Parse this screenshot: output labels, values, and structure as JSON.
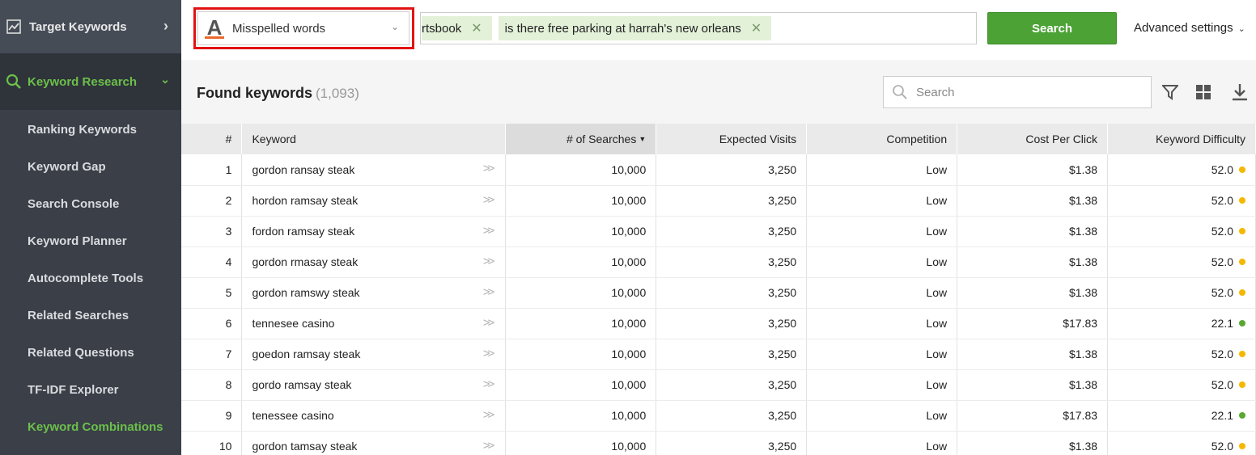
{
  "sidebar": {
    "top_item": "Target Keywords",
    "section": "Keyword Research",
    "items": [
      {
        "label": "Ranking Keywords"
      },
      {
        "label": "Keyword Gap"
      },
      {
        "label": "Search Console"
      },
      {
        "label": "Keyword Planner"
      },
      {
        "label": "Autocomplete Tools"
      },
      {
        "label": "Related Searches"
      },
      {
        "label": "Related Questions"
      },
      {
        "label": "TF-IDF Explorer"
      },
      {
        "label": "Keyword Combinations"
      }
    ],
    "current_item": "Keyword Combinations"
  },
  "topbar": {
    "mode_select": "Misspelled words",
    "mode_icon_letter": "A",
    "tags": [
      "rtsbook",
      "is there free parking at harrah's new orleans"
    ],
    "search_button": "Search",
    "advanced_settings": "Advanced settings"
  },
  "main": {
    "title": "Found keywords",
    "count": "(1,093)",
    "search_placeholder": "Search"
  },
  "table": {
    "headers": {
      "index": "#",
      "keyword": "Keyword",
      "searches": "# of Searches",
      "visits": "Expected Visits",
      "competition": "Competition",
      "cpc": "Cost Per Click",
      "difficulty": "Keyword Difficulty"
    },
    "rows": [
      {
        "idx": "1",
        "keyword": "gordon ransay steak",
        "searches": "10,000",
        "visits": "3,250",
        "competition": "Low",
        "cpc": "$1.38",
        "difficulty": "52.0",
        "dot_color": "#f5b800"
      },
      {
        "idx": "2",
        "keyword": "hordon ramsay steak",
        "searches": "10,000",
        "visits": "3,250",
        "competition": "Low",
        "cpc": "$1.38",
        "difficulty": "52.0",
        "dot_color": "#f5b800"
      },
      {
        "idx": "3",
        "keyword": "fordon ramsay steak",
        "searches": "10,000",
        "visits": "3,250",
        "competition": "Low",
        "cpc": "$1.38",
        "difficulty": "52.0",
        "dot_color": "#f5b800"
      },
      {
        "idx": "4",
        "keyword": "gordon rmasay steak",
        "searches": "10,000",
        "visits": "3,250",
        "competition": "Low",
        "cpc": "$1.38",
        "difficulty": "52.0",
        "dot_color": "#f5b800"
      },
      {
        "idx": "5",
        "keyword": "gordon ramswy steak",
        "searches": "10,000",
        "visits": "3,250",
        "competition": "Low",
        "cpc": "$1.38",
        "difficulty": "52.0",
        "dot_color": "#f5b800"
      },
      {
        "idx": "6",
        "keyword": "tennesee casino",
        "searches": "10,000",
        "visits": "3,250",
        "competition": "Low",
        "cpc": "$17.83",
        "difficulty": "22.1",
        "dot_color": "#5aa832"
      },
      {
        "idx": "7",
        "keyword": "goedon ramsay steak",
        "searches": "10,000",
        "visits": "3,250",
        "competition": "Low",
        "cpc": "$1.38",
        "difficulty": "52.0",
        "dot_color": "#f5b800"
      },
      {
        "idx": "8",
        "keyword": "gordo ramsay steak",
        "searches": "10,000",
        "visits": "3,250",
        "competition": "Low",
        "cpc": "$1.38",
        "difficulty": "52.0",
        "dot_color": "#f5b800"
      },
      {
        "idx": "9",
        "keyword": "tenessee casino",
        "searches": "10,000",
        "visits": "3,250",
        "competition": "Low",
        "cpc": "$17.83",
        "difficulty": "22.1",
        "dot_color": "#5aa832"
      },
      {
        "idx": "10",
        "keyword": "gordon tamsay steak",
        "searches": "10,000",
        "visits": "3,250",
        "competition": "Low",
        "cpc": "$1.38",
        "difficulty": "52.0",
        "dot_color": "#f5b800"
      }
    ]
  },
  "colors": {
    "accent_green": "#4ca235",
    "highlight_red": "#e31212",
    "sidebar_bg": "#3a3f48"
  }
}
